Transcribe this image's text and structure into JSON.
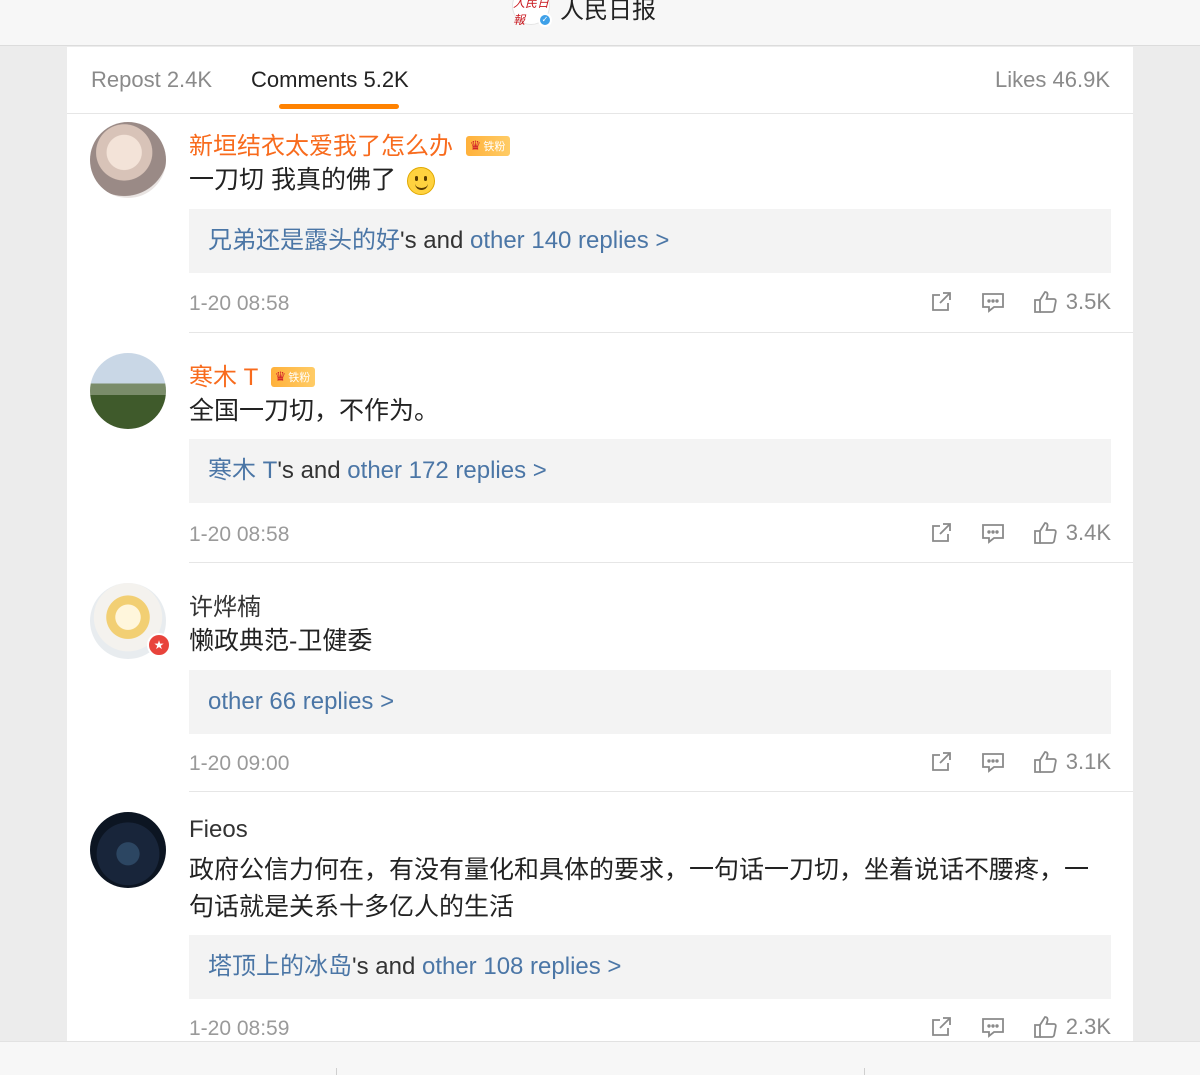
{
  "header": {
    "account_name": "人民日报",
    "avatar_glyph": "人民日報"
  },
  "tabs": {
    "repost": "Repost 2.4K",
    "comments": "Comments 5.2K",
    "likes": "Likes 46.9K"
  },
  "comments": [
    {
      "username": "新垣结衣太爱我了怎么办",
      "fan_badge": "铁粉",
      "text": "一刀切 我真的佛了",
      "reply_user": "兄弟还是露头的好",
      "reply_mid": "'s and ",
      "reply_link": "other 140 replies >",
      "time": "1-20 08:58",
      "likes": "3.5K"
    },
    {
      "username": "寒木 T",
      "fan_badge": "铁粉",
      "text": "全国一刀切，不作为。",
      "reply_user": "寒木 T",
      "reply_mid": "'s and ",
      "reply_link": "other 172 replies >",
      "time": "1-20 08:58",
      "likes": "3.4K"
    },
    {
      "username": "许烨楠",
      "text": "懒政典范-卫健委",
      "reply_link": "other 66 replies >",
      "time": "1-20 09:00",
      "likes": "3.1K"
    },
    {
      "username": "Fieos",
      "text": "政府公信力何在，有没有量化和具体的要求，一句话一刀切，坐着说话不腰疼，一句话就是关系十多亿人的生活",
      "reply_user": "塔顶上的冰岛",
      "reply_mid": "'s and ",
      "reply_link": "other 108 replies >",
      "time": "1-20 08:59",
      "likes": "2.3K"
    }
  ],
  "colors": {
    "accent": "#ff8200",
    "username_highlight": "#f86b1d",
    "link": "#4b76a6"
  },
  "icons": [
    "verified-icon",
    "crown-icon",
    "share-icon",
    "comment-icon",
    "like-icon",
    "smiley-emoji"
  ]
}
